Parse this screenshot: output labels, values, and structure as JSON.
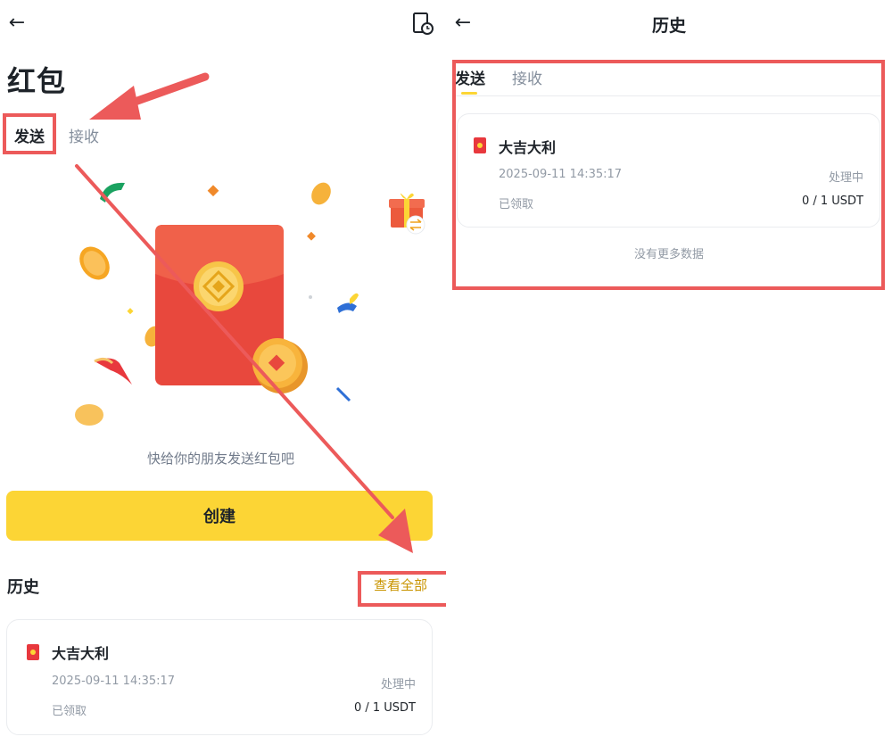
{
  "left": {
    "page_title": "红包",
    "tabs": [
      {
        "label": "发送"
      },
      {
        "label": "接收"
      }
    ],
    "hint": "快给你的朋友发送红包吧",
    "create_button": "创建",
    "history": {
      "title": "历史",
      "view_all": "查看全部",
      "record": {
        "title": "大吉大利",
        "datetime": "2025-09-11 14:35:17",
        "status": "处理中",
        "claimed_label": "已领取",
        "amount": "0 / 1 USDT"
      }
    }
  },
  "right": {
    "header_title": "历史",
    "tabs": [
      {
        "label": "发送"
      },
      {
        "label": "接收"
      }
    ],
    "record": {
      "title": "大吉大利",
      "datetime": "2025-09-11 14:35:17",
      "status": "处理中",
      "claimed_label": "已领取",
      "amount": "0 / 1 USDT"
    },
    "no_more_data": "没有更多数据"
  },
  "icons": {
    "back": "arrow-left-icon",
    "history": "history-clock-icon",
    "envelope": "red-envelope-icon",
    "coin": "bnb-coin-icon",
    "gift": "gift-icon"
  },
  "colors": {
    "accent_yellow": "#FCD535",
    "link_gold": "#C99400",
    "envelope_red": "#E8383D",
    "annotation_red": "#EC5A5A"
  }
}
